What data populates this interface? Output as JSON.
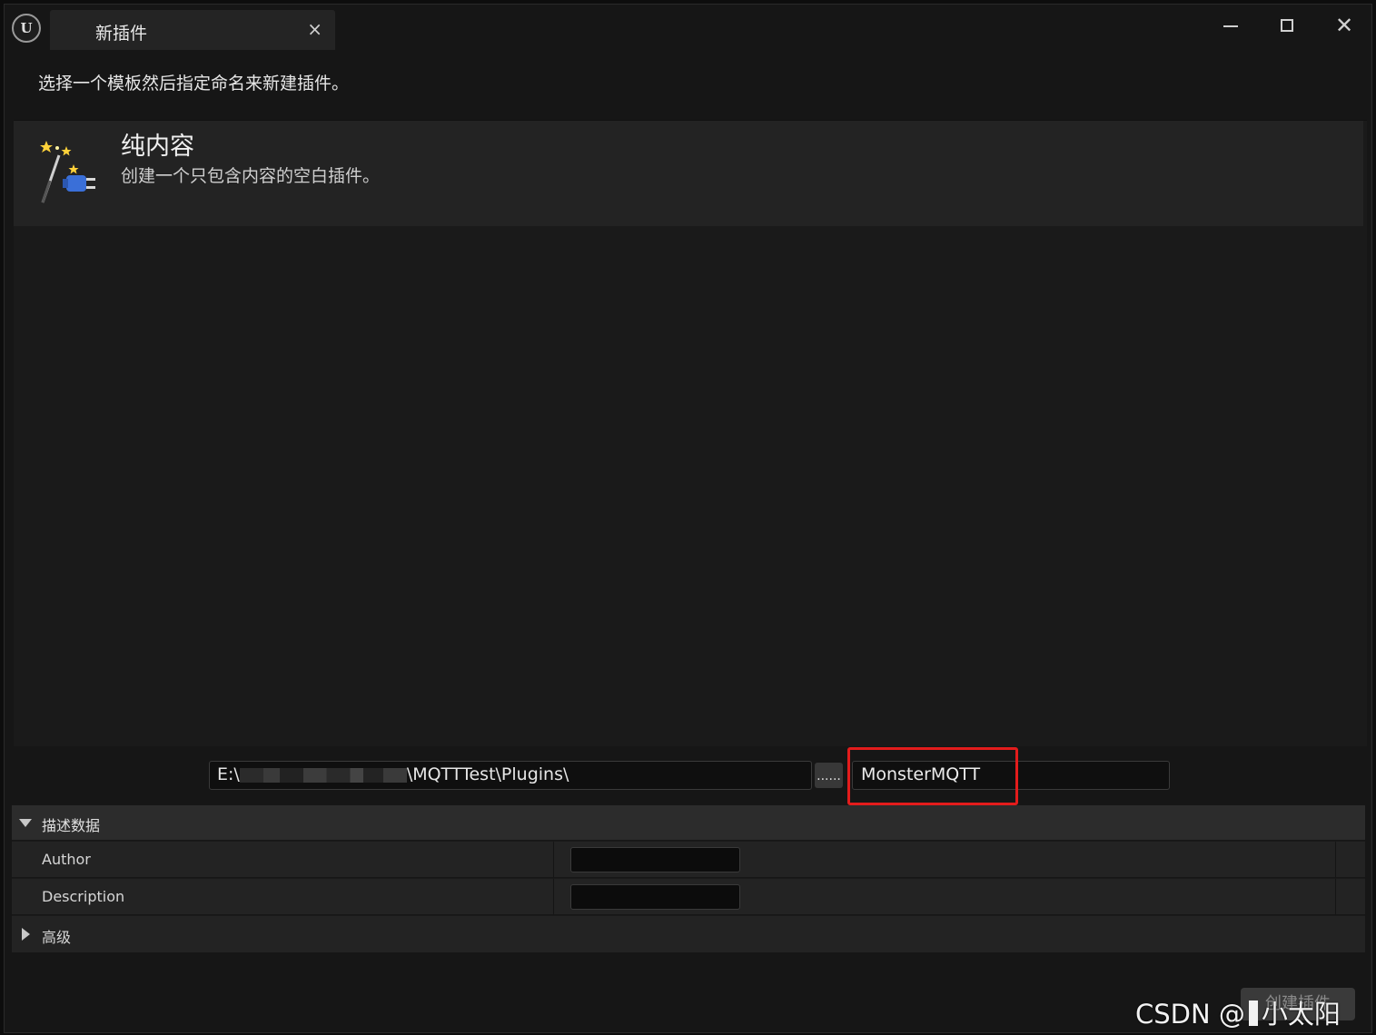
{
  "window": {
    "tab_title": "新插件",
    "tab_close": "×",
    "close_glyph": "✕",
    "app_icon": "unreal-engine-logo",
    "logo_text": "U"
  },
  "instruction": "选择一个模板然后指定命名来新建插件。",
  "templates": [
    {
      "name": "纯内容",
      "description": "创建一个只包含内容的空白插件。",
      "icon": "magic-wand-plugin-icon"
    }
  ],
  "path_row": {
    "path_prefix": "E:\\",
    "path_suffix": "\\MQTTTest\\Plugins\\",
    "browse_label": "......",
    "plugin_name": "MonsterMQTT",
    "highlight_color": "#e31c1c"
  },
  "details": {
    "section_title": "描述数据",
    "author_label": "Author",
    "author_value": "",
    "description_label": "Description",
    "description_value": "",
    "advanced_label": "高级"
  },
  "actions": {
    "create_label": "创建插件"
  },
  "watermark": {
    "prefix": "CSDN @",
    "suffix": "小太阳"
  }
}
